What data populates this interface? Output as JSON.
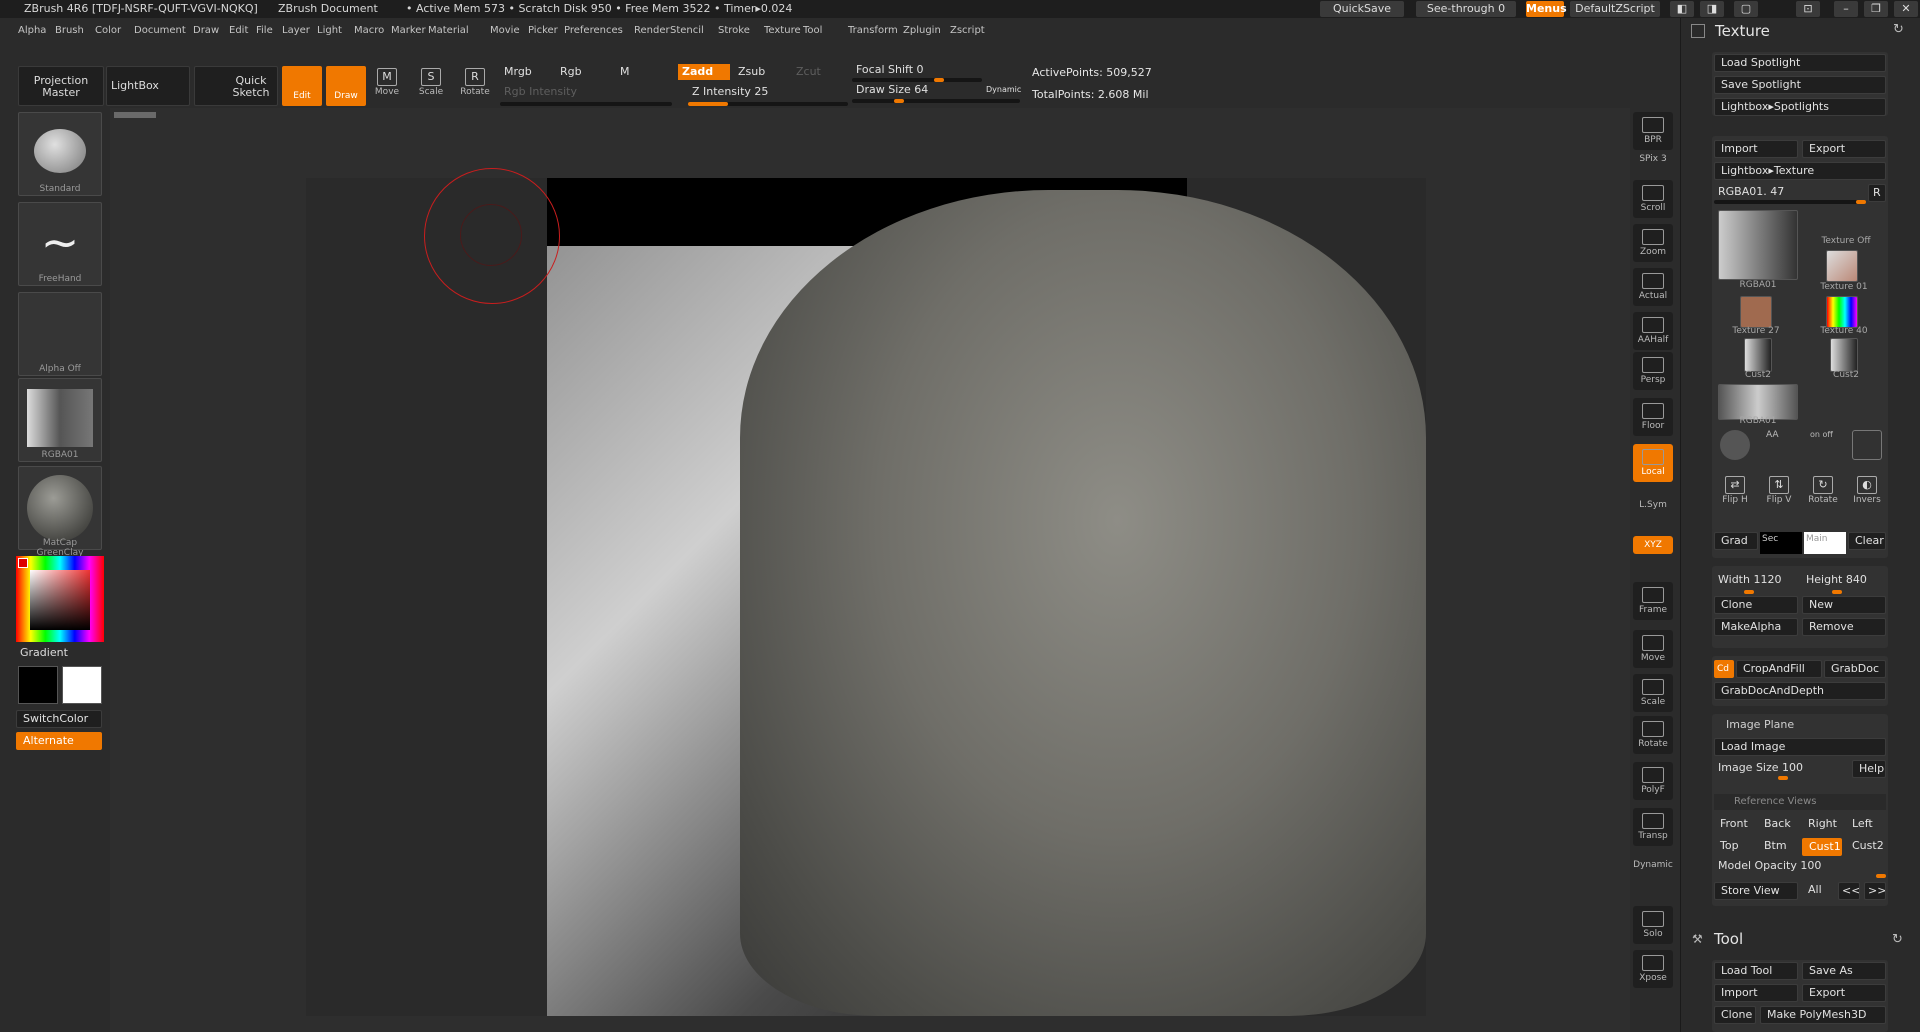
{
  "titlebar": {
    "app": "ZBrush 4R6 [TDFJ-NSRF-QUFT-VGVI-NQKQ]",
    "document": "ZBrush Document",
    "stats": "• Active Mem 573 • Scratch Disk 950 • Free Mem 3522 • Timer▸0.024",
    "quicksave": "QuickSave",
    "seethrough": "See-through  0",
    "menus": "Menus",
    "script": "DefaultZScript"
  },
  "menubar": [
    "Alpha",
    "Brush",
    "Color",
    "Document",
    "Draw",
    "Edit",
    "File",
    "Layer",
    "Light",
    "Macro",
    "Marker",
    "Material",
    "Movie",
    "Picker",
    "Preferences",
    "Render",
    "Stencil",
    "Stroke",
    "Texture",
    "Tool",
    "Transform",
    "Zplugin",
    "Zscript"
  ],
  "shelf": {
    "projection_master": "Projection Master",
    "lightbox": "LightBox",
    "quick_sketch": "Quick Sketch",
    "edit": "Edit",
    "draw": "Draw",
    "move": "Move",
    "scale": "Scale",
    "rotate": "Rotate",
    "mrgb": "Mrgb",
    "rgb": "Rgb",
    "m": "M",
    "rgb_intensity": "Rgb Intensity",
    "zadd": "Zadd",
    "zsub": "Zsub",
    "zcut": "Zcut",
    "z_intensity": "Z Intensity 25",
    "z_intensity_value": 25,
    "focal_shift": "Focal Shift 0",
    "draw_size": "Draw Size 64",
    "dynamic": "Dynamic",
    "active_points": "ActivePoints: 509,527",
    "total_points": "TotalPoints: 2.608 Mil"
  },
  "left": {
    "brush": "Standard",
    "stroke": "FreeHand",
    "alpha": "Alpha Off",
    "texture": "RGBA01",
    "material": "MatCap GreenClay",
    "gradient": "Gradient",
    "switchcolor": "SwitchColor",
    "alternate": "Alternate"
  },
  "dock": [
    "BPR",
    "SPix 3",
    "Scroll",
    "Zoom",
    "Actual",
    "AAHalf",
    "Persp",
    "Floor",
    "Local",
    "L.Sym",
    "XYZ",
    "Frame",
    "Move",
    "Scale",
    "Rotate",
    "PolyF",
    "Transp",
    "Dynamic",
    "Solo",
    "Xpose"
  ],
  "texture": {
    "title": "Texture",
    "load_spotlight": "Load Spotlight",
    "save_spotlight": "Save Spotlight",
    "lightbox_spotlights": "Lightbox▸Spotlights",
    "import": "Import",
    "export": "Export",
    "lightbox_texture": "Lightbox▸Texture",
    "rgba_slider": "RGBA01. 47",
    "r": "R",
    "thumbs": [
      "RGBA01",
      "Texture Off",
      "Texture 01",
      "Texture 27",
      "Texture 40",
      "Cust2",
      "Cust2",
      "RGBA01"
    ],
    "aa_labels": [
      "AA",
      "on  off"
    ],
    "flip_h": "Flip H",
    "flip_v": "Flip V",
    "rotate": "Rotate",
    "invers": "Invers",
    "grad": "Grad",
    "sec": "Sec",
    "main": "Main",
    "clear": "Clear",
    "width": "Width 1120",
    "height": "Height 840",
    "clone": "Clone",
    "new": "New",
    "make_alpha": "MakeAlpha",
    "remove": "Remove",
    "cd": "Cd",
    "crop_and_fill": "CropAndFill",
    "grab_doc": "GrabDoc",
    "grab_doc_depth": "GrabDocAndDepth",
    "image_plane": "Image Plane",
    "load_image": "Load Image",
    "image_size": "Image Size 100",
    "help": "Help",
    "reference_views": "Reference Views",
    "views_row1": [
      "Front",
      "Back",
      "Right",
      "Left"
    ],
    "views_row2": [
      "Top",
      "Btm",
      "Cust1",
      "Cust2"
    ],
    "model_opacity": "Model Opacity 100",
    "store_view": "Store View",
    "all": "All",
    "prev": "<<",
    "next": ">>"
  },
  "tool": {
    "title": "Tool",
    "load_tool": "Load Tool",
    "save_as": "Save As",
    "import": "Import",
    "export": "Export",
    "clone": "Clone",
    "make_polymesh": "Make PolyMesh3D"
  }
}
